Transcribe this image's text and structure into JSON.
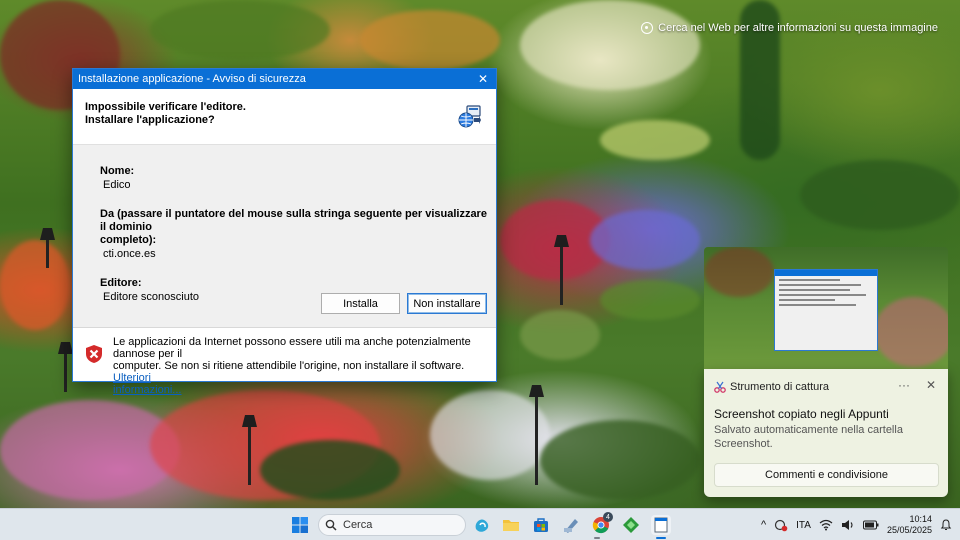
{
  "desktop": {
    "web_hint": "Cerca nel Web per altre informazioni su questa immagine"
  },
  "dialog": {
    "title": "Installazione applicazione - Avviso di sicurezza",
    "close_glyph": "✕",
    "heading_line1": "Impossibile verificare l'editore.",
    "heading_line2": "Installare l'applicazione?",
    "name_label": "Nome:",
    "name_value": "Edico",
    "from_label_line1": "Da (passare il puntatore del mouse sulla stringa seguente per visualizzare il dominio",
    "from_label_line2": "completo):",
    "from_value": "cti.once.es",
    "publisher_label": "Editore:",
    "publisher_value": "Editore sconosciuto",
    "install_button": "Installa",
    "dont_install_button": "Non installare",
    "warning_line1": "Le applicazioni da Internet possono essere utili ma anche potenzialmente dannose per il",
    "warning_line2": "computer. Se non si ritiene attendibile l'origine, non installare il software.",
    "more_info_link_part1": "Ulteriori",
    "more_info_link_part2": "informazioni..."
  },
  "toast": {
    "app_name": "Strumento di cattura",
    "more_glyph": "···",
    "close_glyph": "✕",
    "title": "Screenshot copiato negli Appunti",
    "body": "Salvato automaticamente nella cartella Screenshot.",
    "action_button": "Commenti e condivisione"
  },
  "taskbar": {
    "search_label": "Cerca",
    "chrome_badge": "4",
    "language": "ITA",
    "time": "10:14",
    "date": "25/05/2025",
    "chevron_glyph": "^",
    "accent": "#0a6fd6"
  }
}
